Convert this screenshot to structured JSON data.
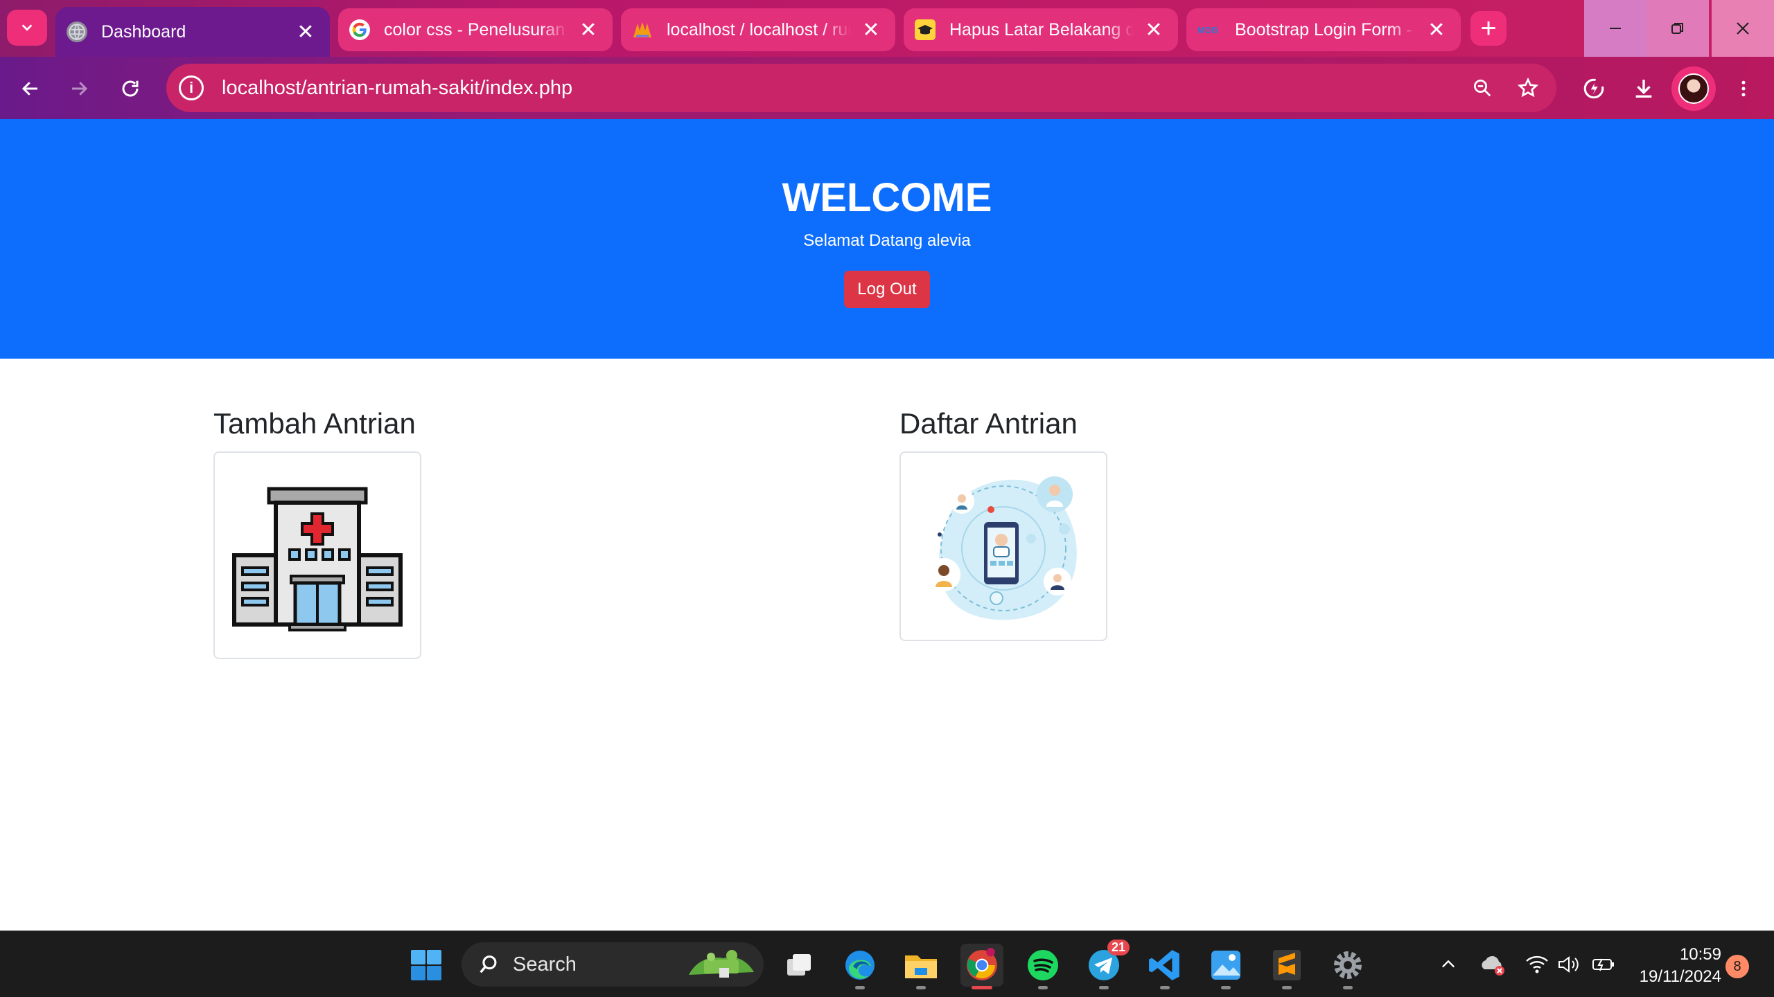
{
  "browser": {
    "tabs": [
      {
        "title": "Dashboard",
        "active": true
      },
      {
        "title": "color css - Penelusuran Google",
        "active": false
      },
      {
        "title": "localhost / localhost / rumah_sakit",
        "active": false
      },
      {
        "title": "Hapus Latar Belakang dari Gambar",
        "active": false
      },
      {
        "title": "Bootstrap Login Form - free",
        "active": false
      }
    ],
    "url": "localhost/antrian-rumah-sakit/index.php"
  },
  "hero": {
    "title": "WELCOME",
    "subtitle": "Selamat Datang alevia",
    "logout_label": "Log Out",
    "color": "#0d6efd"
  },
  "cards": [
    {
      "title": "Tambah Antrian",
      "icon": "hospital-building-icon"
    },
    {
      "title": "Daftar Antrian",
      "icon": "doctor-phone-illustration-icon"
    }
  ],
  "taskbar": {
    "search_label": "Search",
    "telegram_badge": "21",
    "time": "10:59",
    "date": "19/11/2024",
    "notification_count": "8"
  }
}
